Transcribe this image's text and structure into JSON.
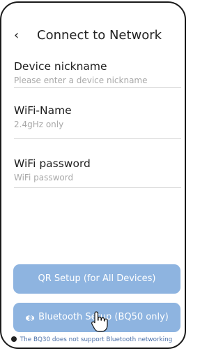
{
  "header": {
    "back_icon": "‹",
    "title": "Connect to Network"
  },
  "fields": [
    {
      "label": "Device nickname",
      "placeholder": "Please enter a device nickname"
    },
    {
      "label": "WiFi-Name",
      "placeholder": "2.4gHz only"
    },
    {
      "label": "WiFi password",
      "placeholder": "WiFi password"
    }
  ],
  "buttons": {
    "qr_label": "QR Setup (for All Devices)",
    "bluetooth_label": "Bluetooth Setup (BQ50 only)"
  },
  "note": {
    "text": "The BQ30 does not support Bluetooth networking"
  },
  "colors": {
    "button_bg": "#8eb4e0",
    "note_text": "#4a6fa8"
  },
  "icons": [
    "back-icon",
    "bluetooth-icon",
    "info-icon",
    "hand-cursor-icon"
  ]
}
